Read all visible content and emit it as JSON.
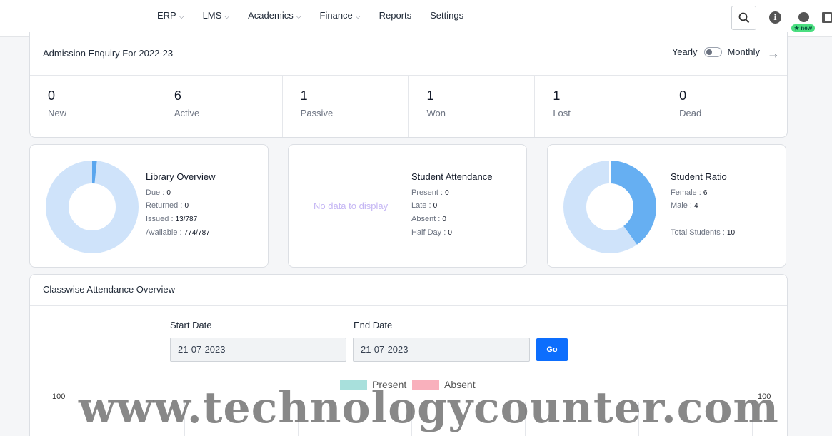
{
  "nav": {
    "items": [
      {
        "label": "ERP",
        "dropdown": true
      },
      {
        "label": "LMS",
        "dropdown": true
      },
      {
        "label": "Academics",
        "dropdown": true
      },
      {
        "label": "Finance",
        "dropdown": true
      },
      {
        "label": "Reports",
        "dropdown": false
      },
      {
        "label": "Settings",
        "dropdown": false
      }
    ],
    "new_badge": "★ new"
  },
  "admission": {
    "title": "Admission Enquiry For 2022-23",
    "toggle_left": "Yearly",
    "toggle_right": "Monthly",
    "stats": [
      {
        "value": "0",
        "label": "New"
      },
      {
        "value": "6",
        "label": "Active"
      },
      {
        "value": "1",
        "label": "Passive"
      },
      {
        "value": "1",
        "label": "Won"
      },
      {
        "value": "1",
        "label": "Lost"
      },
      {
        "value": "0",
        "label": "Dead"
      }
    ]
  },
  "library": {
    "title": "Library Overview",
    "due_label": "Due :",
    "due": "0",
    "returned_label": "Returned :",
    "returned": "0",
    "issued_label": "Issued :",
    "issued": "13/787",
    "available_label": "Available :",
    "available": "774/787",
    "issued_fraction": 0.0165
  },
  "attendance": {
    "title": "Student Attendance",
    "no_data": "No data to display",
    "present_label": "Present :",
    "present": "0",
    "late_label": "Late :",
    "late": "0",
    "absent_label": "Absent :",
    "absent": "0",
    "halfday_label": "Half Day :",
    "halfday": "0"
  },
  "ratio": {
    "title": "Student Ratio",
    "female_label": "Female :",
    "female": "6",
    "male_label": "Male :",
    "male": "4",
    "total_label": "Total Students :",
    "total": "10",
    "male_fraction": 0.4
  },
  "classwise": {
    "title": "Classwise Attendance Overview",
    "start_label": "Start Date",
    "start_value": "21-07-2023",
    "end_label": "End Date",
    "end_value": "21-07-2023",
    "go_label": "Go",
    "legend_present": "Present",
    "legend_absent": "Absent",
    "present_color": "#a8e0dc",
    "absent_color": "#f9b0bc",
    "y_max_left": "100",
    "y_max_right": "100"
  },
  "watermark": "www.technologycounter.com"
}
